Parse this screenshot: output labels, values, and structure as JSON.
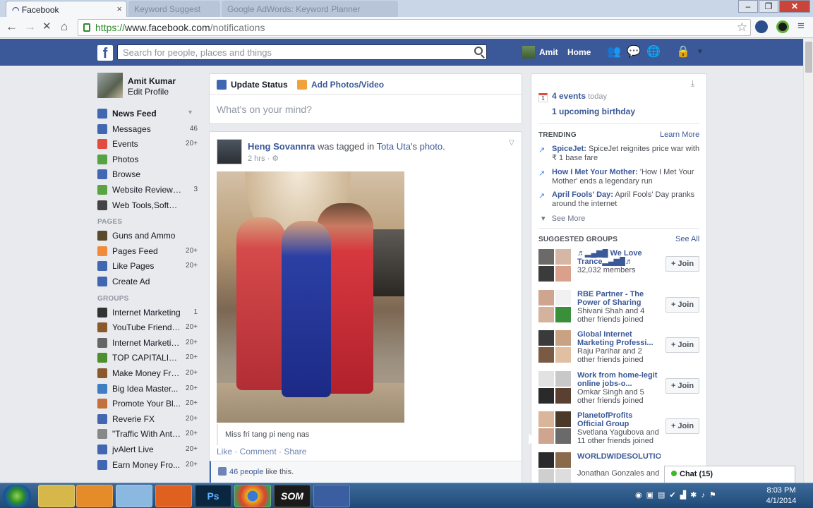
{
  "browser": {
    "tabs": [
      {
        "title": "Facebook"
      },
      {
        "title": "Keyword Suggest"
      },
      {
        "title": "Google AdWords: Keyword Planner"
      }
    ],
    "url_scheme": "https://",
    "url_host": "www.facebook.com",
    "url_path": "/notifications"
  },
  "fb": {
    "logo": "f",
    "search_placeholder": "Search for people, places and things",
    "user": "Amit",
    "home": "Home"
  },
  "left": {
    "profile_name": "Amit Kumar",
    "edit_profile": "Edit Profile",
    "favorites": [
      {
        "label": "News Feed",
        "count": "",
        "icon": "news-feed-icon",
        "color": "#4267b2"
      },
      {
        "label": "Messages",
        "count": "46",
        "icon": "messages-icon",
        "color": "#4267b2"
      },
      {
        "label": "Events",
        "count": "20+",
        "icon": "calendar-icon",
        "color": "#e34b3e"
      },
      {
        "label": "Photos",
        "count": "",
        "icon": "photos-icon",
        "color": "#56a344"
      },
      {
        "label": "Browse",
        "count": "",
        "icon": "browse-icon",
        "color": "#4267b2"
      },
      {
        "label": "Website Reviews,S...",
        "count": "3",
        "icon": "leaf-icon",
        "color": "#5aa541"
      },
      {
        "label": "Web Tools,Software ...",
        "count": "",
        "icon": "tools-icon",
        "color": "#444444"
      }
    ],
    "pages_header": "PAGES",
    "pages": [
      {
        "label": "Guns and Ammo",
        "count": "",
        "icon": "guns-icon",
        "color": "#5a4a2a"
      },
      {
        "label": "Pages Feed",
        "count": "20+",
        "icon": "flag-icon",
        "color": "#f28a3c"
      },
      {
        "label": "Like Pages",
        "count": "20+",
        "icon": "like-icon",
        "color": "#4267b2"
      },
      {
        "label": "Create Ad",
        "count": "",
        "icon": "ad-icon",
        "color": "#4267b2"
      }
    ],
    "groups_header": "GROUPS",
    "groups": [
      {
        "label": "Internet Marketing",
        "count": "1",
        "icon": "group-icon",
        "color": "#333333"
      },
      {
        "label": "YouTube Friends...",
        "count": "20+",
        "icon": "group-icon",
        "color": "#8a5a2b"
      },
      {
        "label": "Internet Marketin...",
        "count": "20+",
        "icon": "group-icon",
        "color": "#666666"
      },
      {
        "label": "TOP CAPITALIST...",
        "count": "20+",
        "icon": "group-icon",
        "color": "#4e8f2e"
      },
      {
        "label": "Make Money Fro...",
        "count": "20+",
        "icon": "group-icon",
        "color": "#8a5a2b"
      },
      {
        "label": "Big Idea Master...",
        "count": "20+",
        "icon": "group-icon",
        "color": "#3d7fc2"
      },
      {
        "label": "Promote Your Bl...",
        "count": "20+",
        "icon": "group-icon",
        "color": "#c2703d"
      },
      {
        "label": "Reverie FX",
        "count": "20+",
        "icon": "group-icon",
        "color": "#4267b2"
      },
      {
        "label": "\"Traffic With Anth...",
        "count": "20+",
        "icon": "group-icon",
        "color": "#888888"
      },
      {
        "label": "jvAlert Live",
        "count": "20+",
        "icon": "group-icon",
        "color": "#4267b2"
      },
      {
        "label": "Earn Money Fro...",
        "count": "20+",
        "icon": "group-icon",
        "color": "#4267b2"
      }
    ]
  },
  "composer": {
    "update_status": "Update Status",
    "add_photos": "Add Photos/Video",
    "placeholder": "What's on your mind?"
  },
  "post": {
    "author": "Heng Sovannra",
    "verb": " was tagged in ",
    "tagged": "Tota Uta",
    "suffix": "'s ",
    "photo_link": "photo",
    "period": ".",
    "time": "2 hrs · ",
    "caption": "Miss fri tang pi neng nas",
    "actions": "Like · Comment · Share",
    "likes_count": "46 people",
    "likes_suffix": " like this."
  },
  "right": {
    "events_count": "4 events",
    "events_suffix": " today",
    "birthday": "1 upcoming birthday",
    "trending_header": "TRENDING",
    "learn_more": "Learn More",
    "trends": [
      {
        "topic": "SpiceJet:",
        "text": " SpiceJet reignites price war with ₹ 1 base fare"
      },
      {
        "topic": "How I Met Your Mother:",
        "text": " 'How I Met Your Mother' ends a legendary run"
      },
      {
        "topic": "April Fools' Day:",
        "text": " April Fools' Day pranks around the internet"
      }
    ],
    "see_more": "See More",
    "groups_header": "SUGGESTED GROUPS",
    "see_all": "See All",
    "join": "+ Join",
    "suggested": [
      {
        "name": "♬▂▄▆█ We Love Trance▂▄▆█♬",
        "sub": "32,032 members"
      },
      {
        "name": "RBE Partner - The Power of Sharing",
        "sub": "Shivani Shah and 4 other friends joined"
      },
      {
        "name": "Global Internet Marketing Professi...",
        "sub": "Raju Parihar and 2 other friends joined"
      },
      {
        "name": "Work from home-legit online jobs-o...",
        "sub": "Omkar Singh and 5 other friends joined"
      },
      {
        "name": "PlanetofProfits Official Group",
        "sub": "Svetlana Yagubova and 11 other friends joined"
      },
      {
        "name": "WORLDWIDESOLUTIONM",
        "sub": "Jonathan Gonzales and"
      }
    ]
  },
  "chat": {
    "label": "Chat (15)"
  },
  "taskbar": {
    "apps": [
      "",
      "",
      "",
      "",
      "Ps",
      "",
      "SOM",
      ""
    ],
    "time": "8:03 PM",
    "date": "4/1/2014"
  }
}
